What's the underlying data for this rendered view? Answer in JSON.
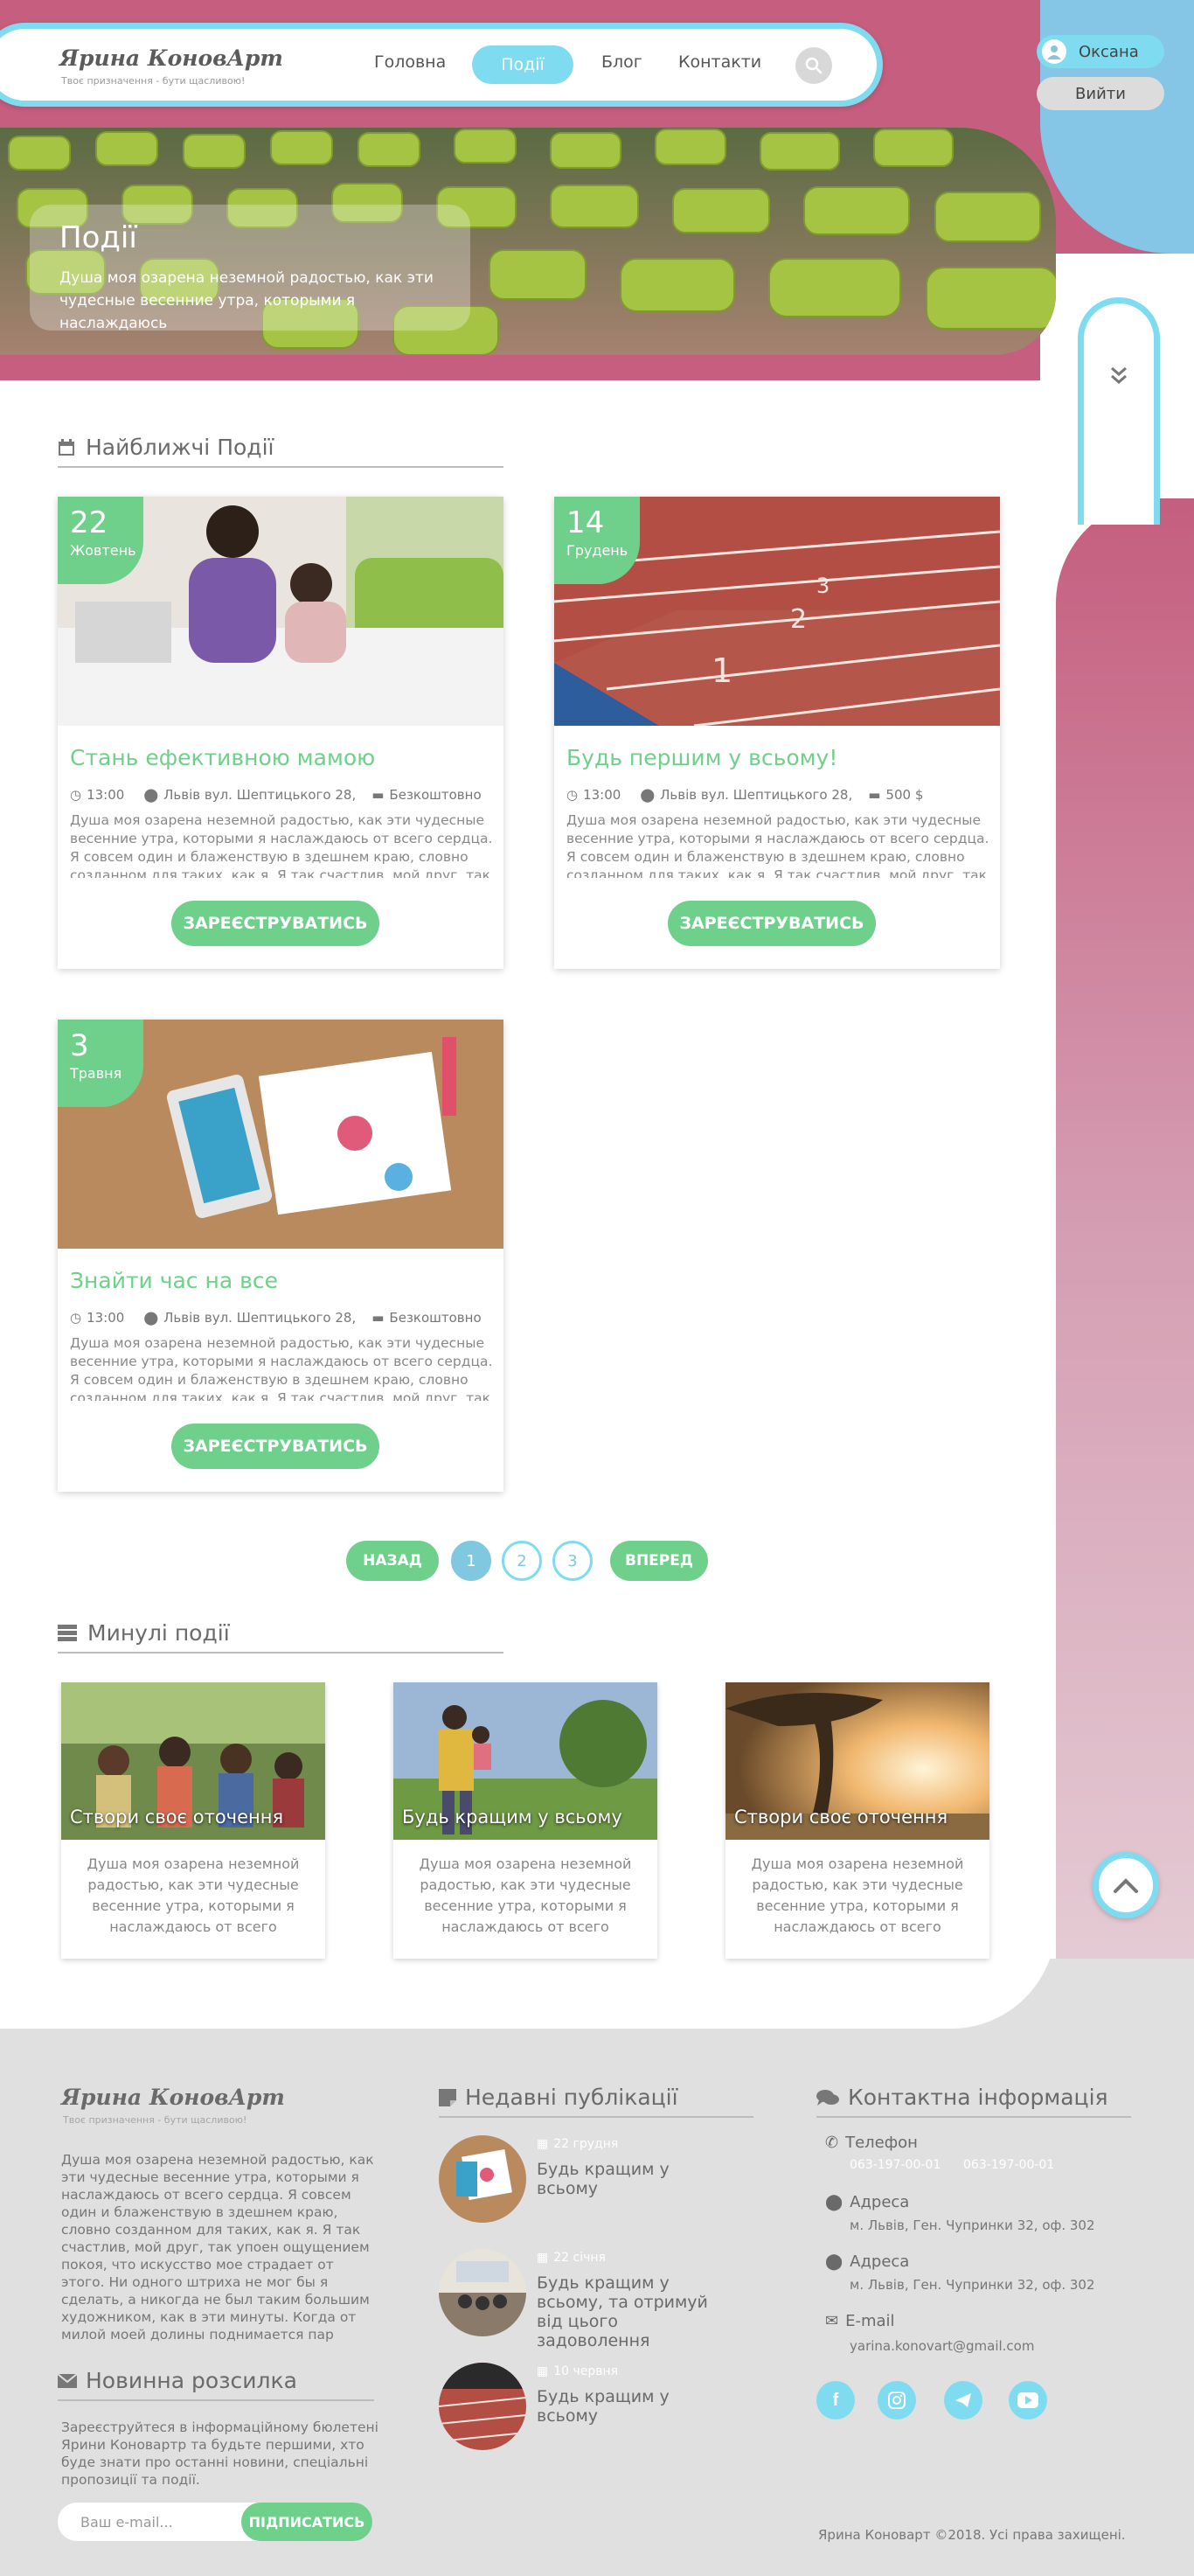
{
  "header": {
    "logo_title": "Ярина КоновАрт",
    "logo_subtitle": "Твоє призначення - бути щасливою!",
    "nav": [
      "Головна",
      "Події",
      "Блог",
      "Контакти"
    ],
    "nav_active": "Події",
    "user_name": "Оксана",
    "logout_label": "Вийти"
  },
  "hero": {
    "title": "Події",
    "description": "Душа моя озарена неземной радостью, как эти чудесные весенние утра, которыми я наслаждаюсь"
  },
  "upcoming": {
    "heading": "Найближчі Події",
    "events": [
      {
        "day": "22",
        "month": "Жовтень",
        "title": "Стань ефективною мамою",
        "time": "13:00",
        "address": "Львів вул. Шептицького 28,",
        "price": "Безкоштовно",
        "description": "Душа моя озарена неземной радостью, как эти чудесные весенние утра, которыми я наслаждаюсь от всего сердца. Я совсем один и блаженствую в здешнем краю, словно созданном для таких, как я. Я так счастлив, мой друг, так упоен",
        "button": "ЗАРЕЄСТРУВАТИСЬ"
      },
      {
        "day": "14",
        "month": "Грудень",
        "title": "Будь першим у всьому!",
        "time": "13:00",
        "address": "Львів вул. Шептицького 28,",
        "price": "500 $",
        "description": "Душа моя озарена неземной радостью, как эти чудесные весенние утра, которыми я наслаждаюсь от всего сердца. Я совсем один и блаженствую в здешнем краю, словно созданном для таких, как я. Я так счастлив, мой друг, так упоен",
        "button": "ЗАРЕЄСТРУВАТИСЬ"
      },
      {
        "day": "3",
        "month": "Травня",
        "title": "Знайти час на все",
        "time": "13:00",
        "address": "Львів вул. Шептицького 28,",
        "price": "Безкоштовно",
        "description": "Душа моя озарена неземной радостью, как эти чудесные весенние утра, которыми я наслаждаюсь от всего сердца. Я совсем один и блаженствую в здешнем краю, словно созданном для таких, как я. Я так счастлив, мой друг, так упоен",
        "button": "ЗАРЕЄСТРУВАТИСЬ"
      }
    ]
  },
  "pagination": {
    "prev": "НАЗАД",
    "pages": [
      "1",
      "2",
      "3"
    ],
    "current": "1",
    "next": "ВПЕРЕД"
  },
  "past": {
    "heading": "Минулі події",
    "events": [
      {
        "title": "Створи своє оточення",
        "description": "Душа моя озарена неземной радостью, как эти чудесные весенние утра, которыми я наслаждаюсь от всего сердца. Я"
      },
      {
        "title": "Будь кращим у всьому",
        "description": "Душа моя озарена неземной радостью, как эти чудесные весенние утра, которыми я наслаждаюсь от всего сердца. Я"
      },
      {
        "title": "Створи своє оточення",
        "description": "Душа моя озарена неземной радостью, как эти чудесные весенние утра, которыми я наслаждаюсь от всего сердца. Я"
      }
    ]
  },
  "footer": {
    "logo_title": "Ярина КоновАрт",
    "logo_subtitle": "Твоє призначення - бути щасливою!",
    "about": "Душа моя озарена неземной радостью, как эти чудесные весенние утра, которыми я наслаждаюсь от всего сердца. Я совсем один и блаженствую в здешнем краю, словно созданном для таких, как я. Я так счастлив, мой друг, так упоен ощущением покоя, что искусство мое страдает от этого. Ни одного штриха не мог бы я сделать, а никогда не был таким большим художником, как в эти минуты. Когда от милой моей долины поднимается пар",
    "newsletter_heading": "Новинна розсилка",
    "newsletter_text": "Зареєструйтеся в інформаційному бюлетені Ярини Коновартр та будьте першими, хто буде знати про останні новини, спеціальні пропозиції та події.",
    "email_placeholder": "Ваш e-mail...",
    "subscribe_label": "ПІДПИСАТИСЬ",
    "recent_heading": "Недавні публікації",
    "posts": [
      {
        "date": "22 грудня",
        "title": "Будь кращим у всьому"
      },
      {
        "date": "22 січня",
        "title": "Будь кращим у всьому, та отримуй від цього задоволення"
      },
      {
        "date": "10 червня",
        "title": "Будь кращим у всьому"
      }
    ],
    "contact_heading": "Контактна інформація",
    "phone_label": "Телефон",
    "phones": [
      "063-197-00-01",
      "063-197-00-01"
    ],
    "address_label": "Адреса",
    "addresses": [
      "м. Львів, Ген. Чупринки 32, оф. 302",
      "м. Львів, Ген. Чупринки 32, оф. 302"
    ],
    "email_label": "E-mail",
    "email": "yarina.konovart@gmail.com",
    "copyright": "Ярина Коноварт ©2018. Усі права захищені.",
    "social_icons": [
      "facebook-icon",
      "instagram-icon",
      "telegram-icon",
      "youtube-icon"
    ]
  },
  "colors": {
    "pink": "#c55e7f",
    "cyan": "#7fdcf0",
    "blue": "#85c5e6",
    "green": "#6fd08c",
    "footer_bg": "#e0e0e0"
  }
}
